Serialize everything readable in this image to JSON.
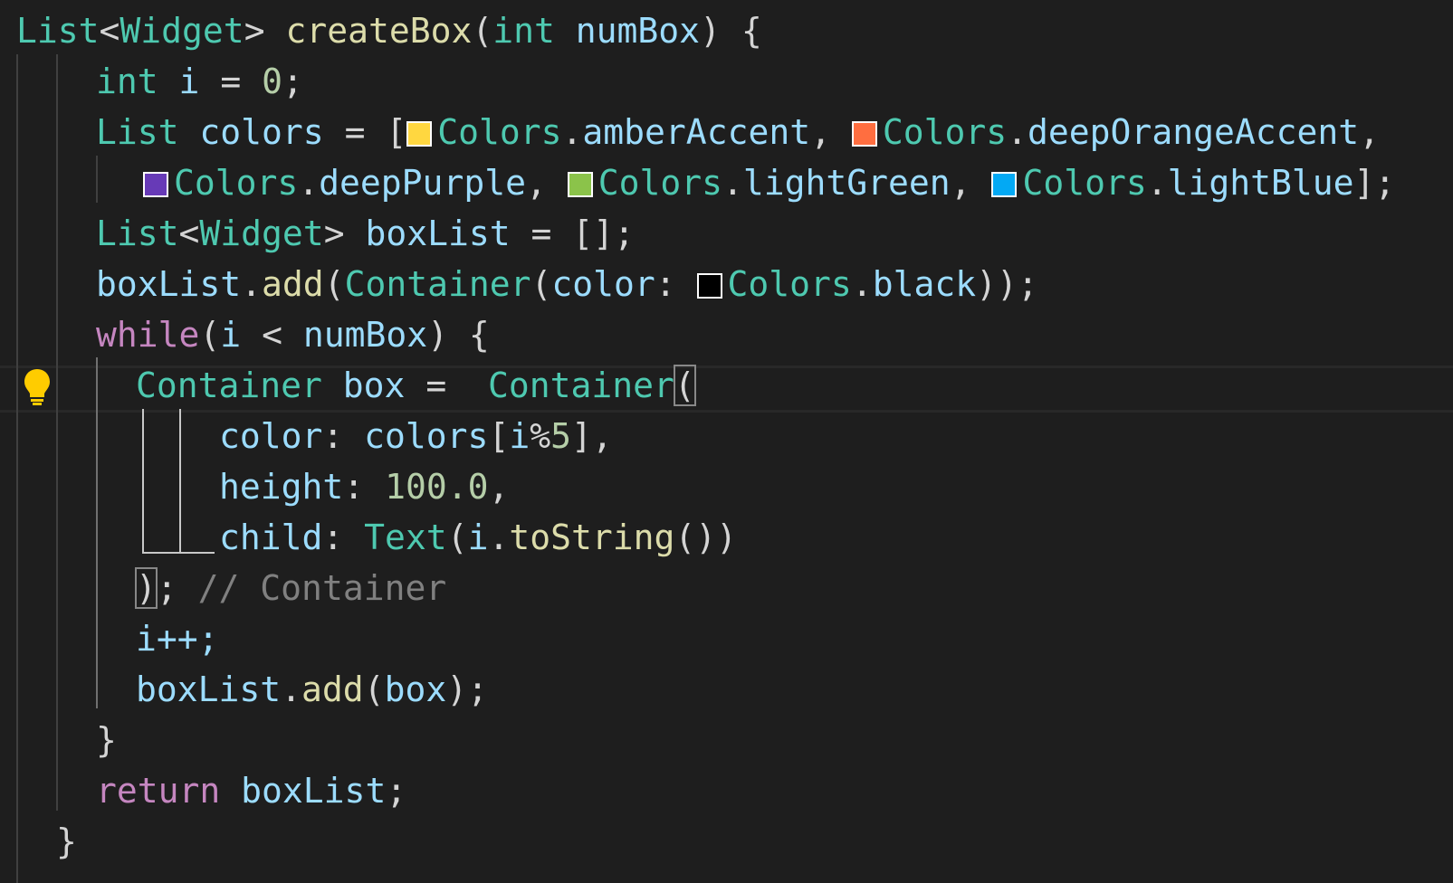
{
  "code": {
    "l1": {
      "type_list": "List",
      "lt": "<",
      "type_widget": "Widget",
      "gt": ">",
      "fn_name": "createBox",
      "paren_open": "(",
      "kw_int": "int",
      "param": "numBox",
      "paren_close": ")",
      "brace": "{"
    },
    "l2": {
      "kw_int": "int",
      "var_i": "i",
      "op": "=",
      "num": "0",
      "semi": ";"
    },
    "l3": {
      "type_list": "List",
      "var": "colors",
      "op": "=",
      "bracket": "[",
      "c1_class": "Colors",
      "c1_dot": ".",
      "c1_prop": "amberAccent",
      "comma1": ",",
      "c2_class": "Colors",
      "c2_dot": ".",
      "c2_prop": "deepOrangeAccent",
      "comma2": ","
    },
    "l4": {
      "c3_class": "Colors",
      "c3_dot": ".",
      "c3_prop": "deepPurple",
      "comma3": ",",
      "c4_class": "Colors",
      "c4_dot": ".",
      "c4_prop": "lightGreen",
      "comma4": ",",
      "c5_class": "Colors",
      "c5_dot": ".",
      "c5_prop": "lightBlue",
      "end": "];"
    },
    "l5": {
      "type_list": "List",
      "lt": "<",
      "type_widget": "Widget",
      "gt": ">",
      "var": "boxList",
      "op": "=",
      "value": "[];"
    },
    "l6": {
      "obj": "boxList",
      "dot": ".",
      "method": "add",
      "po": "(",
      "cls": "Container",
      "po2": "(",
      "param": "color",
      "colon": ":",
      "c_class": "Colors",
      "c_dot": ".",
      "c_prop": "black",
      "pc": "));"
    },
    "l7": {
      "kw": "while",
      "po": "(",
      "var_i": "i",
      "op": "<",
      "param": "numBox",
      "pc": ")",
      "brace": "{"
    },
    "l8": {
      "cls": "Container",
      "var": "box",
      "op": "=",
      "cls2": "Container",
      "po": "("
    },
    "l9": {
      "param": "color",
      "colon": ":",
      "var": "colors",
      "bo": "[",
      "idx": "i%5",
      "bc": "],",
      "idx_i": "i",
      "idx_op": "%",
      "idx_n": "5"
    },
    "l10": {
      "param": "height",
      "colon": ":",
      "num": "100.0",
      "comma": ","
    },
    "l11": {
      "param": "child",
      "colon": ":",
      "cls": "Text",
      "po": "(",
      "var_i": "i",
      "dot": ".",
      "method": "toString",
      "pc": "())"
    },
    "l12": {
      "pc": ")",
      "semi": ";",
      "comment": "// Container"
    },
    "l13": {
      "stmt": "i++;"
    },
    "l14": {
      "obj": "boxList",
      "dot": ".",
      "method": "add",
      "po": "(",
      "arg": "box",
      "pc": ");"
    },
    "l15": {
      "brace": "}"
    },
    "l16": {
      "kw": "return",
      "var": "boxList",
      "semi": ";"
    },
    "l17": {
      "brace": "}"
    }
  },
  "swatch_colors": {
    "amberAccent": "#FFD740",
    "deepOrangeAccent": "#FF6E40",
    "deepPurple": "#673AB7",
    "lightGreen": "#8BC34A",
    "lightBlue": "#03A9F4",
    "black": "#000000"
  },
  "icons": {
    "lightbulb": "lightbulb-icon"
  }
}
